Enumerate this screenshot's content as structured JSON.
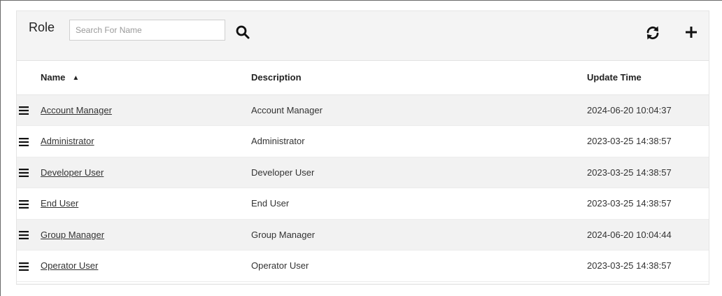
{
  "toolbar": {
    "title": "Role",
    "search_placeholder": "Search For Name",
    "search_value": ""
  },
  "table": {
    "columns": {
      "name": "Name",
      "name_sort": "▲",
      "description": "Description",
      "update_time": "Update Time"
    },
    "rows": [
      {
        "name": "Account Manager",
        "description": "Account Manager",
        "update_time": "2024-06-20 10:04:37"
      },
      {
        "name": "Administrator",
        "description": "Administrator",
        "update_time": "2023-03-25 14:38:57"
      },
      {
        "name": "Developer User",
        "description": "Developer User",
        "update_time": "2023-03-25 14:38:57"
      },
      {
        "name": "End User",
        "description": "End User",
        "update_time": "2023-03-25 14:38:57"
      },
      {
        "name": "Group Manager",
        "description": "Group Manager",
        "update_time": "2024-06-20 10:04:44"
      },
      {
        "name": "Operator User",
        "description": "Operator User",
        "update_time": "2023-03-25 14:38:57"
      }
    ]
  },
  "icons": {
    "search": "search-icon",
    "refresh": "refresh-icon",
    "add": "plus-icon",
    "drag": "drag-handle-icon",
    "sort": "sort-ascending-icon"
  }
}
